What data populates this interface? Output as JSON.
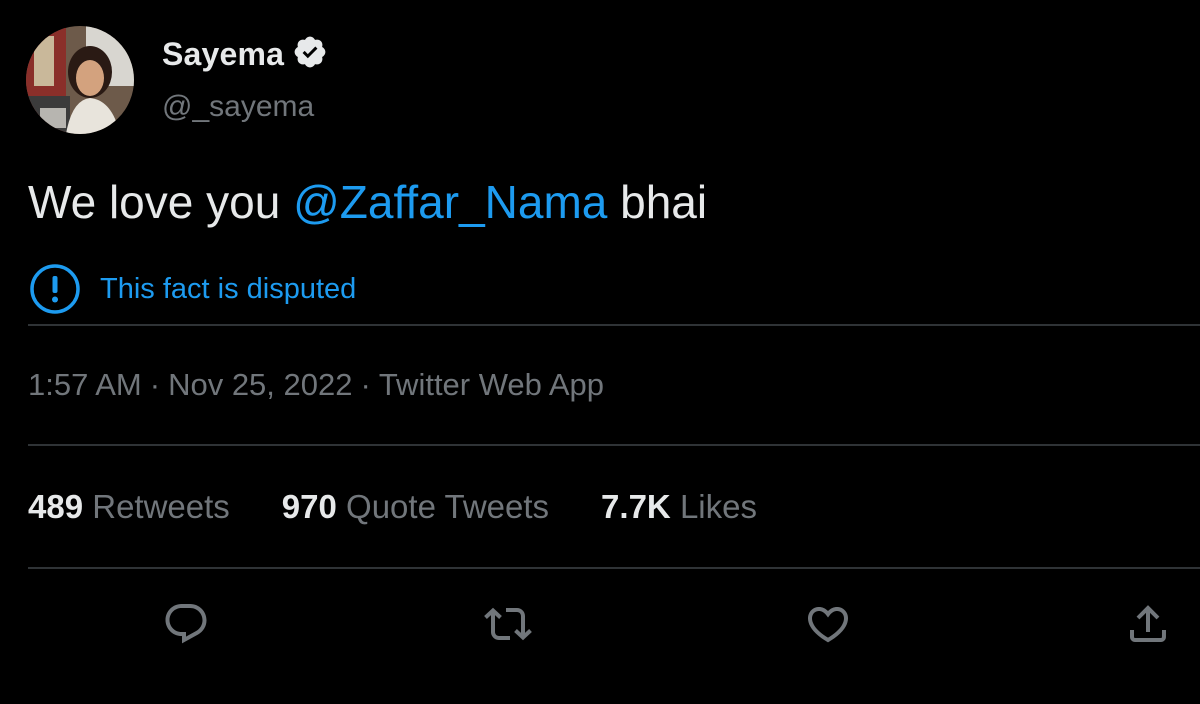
{
  "author": {
    "display_name": "Sayema",
    "handle": "@_sayema",
    "verified": true
  },
  "tweet": {
    "text_before": "We love you ",
    "mention": "@Zaffar_Nama",
    "text_after": " bhai",
    "notice": "This fact is disputed",
    "time": "1:57 AM",
    "date": "Nov 25, 2022",
    "source": "Twitter Web App",
    "separator": "·"
  },
  "stats": {
    "retweets_count": "489",
    "retweets_label": "Retweets",
    "quotes_count": "970",
    "quotes_label": "Quote Tweets",
    "likes_count": "7.7K",
    "likes_label": "Likes"
  },
  "colors": {
    "accent": "#1d9bf0",
    "text": "#e7e9ea",
    "secondary": "#71767b",
    "divider": "#2f3336",
    "background": "#000000"
  },
  "icons": {
    "verified": "verified-badge-icon",
    "notice": "exclamation-circle-icon",
    "reply": "reply-icon",
    "retweet": "retweet-icon",
    "like": "heart-icon",
    "share": "share-icon"
  }
}
